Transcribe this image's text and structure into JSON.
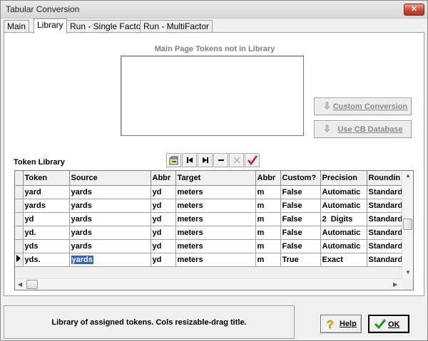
{
  "window": {
    "title": "Tabular Conversion",
    "close_label": "✕"
  },
  "tabs": [
    {
      "label": "Main"
    },
    {
      "label": "Library"
    },
    {
      "label": "Run - Single Factor"
    },
    {
      "label": "Run - MultiFactor"
    }
  ],
  "main_page": {
    "label": "Main Page Tokens not in Library",
    "items": []
  },
  "buttons": {
    "custom_conversion": "Custom Conversion",
    "use_cb_database": "Use CB Database",
    "help": "Help",
    "ok": "OK"
  },
  "token_library": {
    "label": "Token Library",
    "columns": [
      "Token",
      "Source",
      "Abbr",
      "Target",
      "Abbr",
      "Custom?",
      "Precision",
      "Roundin"
    ],
    "rows": [
      {
        "token": "yard",
        "source": "yards",
        "abbr1": "yd",
        "target": "meters",
        "abbr2": "m",
        "custom": "False",
        "precision": "Automatic",
        "rounding": "Standard"
      },
      {
        "token": "yards",
        "source": "yards",
        "abbr1": "yd",
        "target": "meters",
        "abbr2": "m",
        "custom": "False",
        "precision": "Automatic",
        "rounding": "Standard"
      },
      {
        "token": "yd",
        "source": "yards",
        "abbr1": "yd",
        "target": "meters",
        "abbr2": "m",
        "custom": "False",
        "precision": "2  Digits",
        "rounding": "Standard"
      },
      {
        "token": "yd.",
        "source": "yards",
        "abbr1": "yd",
        "target": "meters",
        "abbr2": "m",
        "custom": "False",
        "precision": "Automatic",
        "rounding": "Standard"
      },
      {
        "token": "yds",
        "source": "yards",
        "abbr1": "yd",
        "target": "meters",
        "abbr2": "m",
        "custom": "False",
        "precision": "Automatic",
        "rounding": "Standard"
      },
      {
        "token": "yds.",
        "source": "yards",
        "abbr1": "yd",
        "target": "meters",
        "abbr2": "m",
        "custom": "True",
        "precision": "Exact",
        "rounding": "Standard"
      }
    ],
    "current_row": 5,
    "selected_cell": "source"
  },
  "status": {
    "text": "Library of assigned tokens. Cols resizable-drag title."
  },
  "colors": {
    "selection": "#3163c5",
    "check": "#d01818",
    "ok_check": "#1a9a1a",
    "help_q": "#f0c000"
  }
}
